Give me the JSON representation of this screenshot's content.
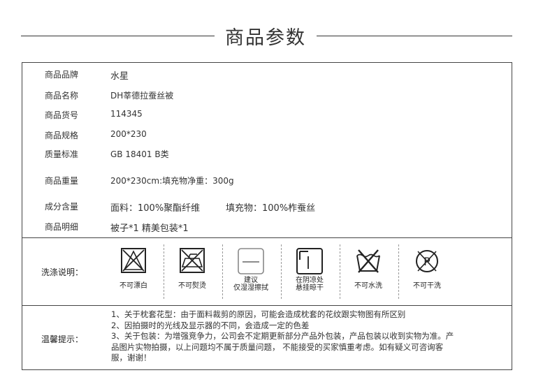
{
  "header": {
    "title": "商品参数"
  },
  "specs": [
    {
      "label": "商品品牌",
      "value": "水星"
    },
    {
      "label": "商品名称",
      "value": "DH莘德拉蚕丝被"
    },
    {
      "label": "商品货号",
      "value": "114345"
    },
    {
      "label": "商品规格",
      "value": "200*230"
    },
    {
      "label": "质量标准",
      "value": "GB 18401 B类"
    },
    {
      "label": "商品重量",
      "value": "200*230cm:填充物净重：300g"
    },
    {
      "label": "成分含量",
      "value": "面料：100%聚酯纤维",
      "value2": "填充物：100%柞蚕丝"
    },
    {
      "label": "商品明细",
      "value": "被子*1 精美包装*1"
    }
  ],
  "care": {
    "label": "洗涤说明：",
    "symbols": [
      {
        "icon": "no-bleach-icon",
        "caption": "不可漂白"
      },
      {
        "icon": "no-iron-icon",
        "caption": "不可熨烫"
      },
      {
        "icon": "wipe-dry-icon",
        "caption": "建议",
        "caption2": "仅湿湿擦拭"
      },
      {
        "icon": "shade-dry-icon",
        "caption": "在阴凉处",
        "caption2": "悬挂晾干"
      },
      {
        "icon": "no-wash-icon",
        "caption": "不可水洗"
      },
      {
        "icon": "no-dry-clean-icon",
        "caption": "不可干洗"
      }
    ]
  },
  "notes": {
    "label": "温馨提示：",
    "lines": [
      "1、关于枕套花型：由于面料裁剪的原因，可能会造成枕套的花纹跟实物图有所区别",
      "2、因拍摄时的光线及显示器的不同，会造成一定的色差",
      "3、关于包装：为增强竞争力，公司会不定期更新部分产品外包装，产品包装以收到实物为准。产",
      "品图片实物拍摄，以上问题均不属于质量问题， 不能接受的买家慎重考虑。如有疑义可咨询客",
      "服，谢谢！"
    ]
  }
}
